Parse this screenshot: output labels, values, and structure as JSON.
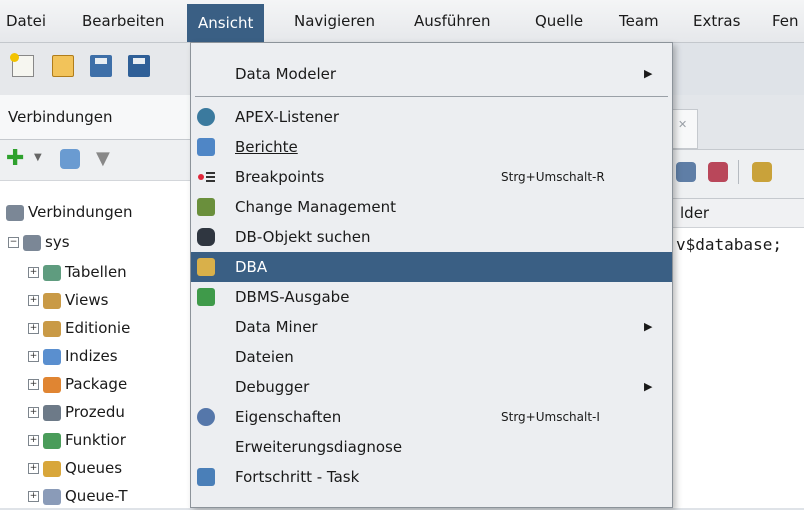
{
  "menubar": {
    "items": [
      {
        "label": "Datei"
      },
      {
        "label": "Bearbeiten"
      },
      {
        "label": "Ansicht"
      },
      {
        "label": "Navigieren"
      },
      {
        "label": "Ausführen"
      },
      {
        "label": "Quelle"
      },
      {
        "label": "Team"
      },
      {
        "label": "Extras"
      },
      {
        "label": "Fen"
      }
    ],
    "active": "Ansicht"
  },
  "toolbar": {
    "icons": [
      "new-icon",
      "open-folder-icon",
      "save-icon",
      "save-all-icon"
    ]
  },
  "connections_panel": {
    "tab_label": "Verbindungen",
    "tree": [
      {
        "label": "Verbindungen",
        "icon": "connections-icon"
      },
      {
        "label": "sys",
        "icon": "database-connection-icon"
      },
      {
        "label": "Tabellen",
        "icon": "table-icon"
      },
      {
        "label": "Views",
        "icon": "view-icon"
      },
      {
        "label": "Editionie",
        "icon": "editioning-view-icon"
      },
      {
        "label": "Indizes",
        "icon": "index-icon"
      },
      {
        "label": "Package",
        "icon": "package-icon"
      },
      {
        "label": "Prozedu",
        "icon": "procedure-icon"
      },
      {
        "label": "Funktior",
        "icon": "function-icon"
      },
      {
        "label": "Queues",
        "icon": "queue-icon"
      },
      {
        "label": "Queue-T",
        "icon": "queue-table-icon"
      }
    ]
  },
  "editor": {
    "column_header": "lder",
    "code_line": "v$database;"
  },
  "view_menu": {
    "items": [
      {
        "label": "Data Modeler",
        "submenu": true
      },
      {
        "separator": true
      },
      {
        "label": "APEX-Listener",
        "icon": "apex-listener-icon"
      },
      {
        "label": "Berichte",
        "icon": "reports-icon"
      },
      {
        "label": "Breakpoints",
        "icon": "breakpoints-icon",
        "accel": "Strg+Umschalt-R"
      },
      {
        "label": "Change Management",
        "icon": "change-management-icon"
      },
      {
        "label": "DB-Objekt suchen",
        "icon": "binoculars-icon"
      },
      {
        "label": "DBA",
        "icon": "dba-icon",
        "highlighted": true
      },
      {
        "label": "DBMS-Ausgabe",
        "icon": "dbms-output-icon"
      },
      {
        "label": "Data Miner",
        "submenu": true
      },
      {
        "label": "Dateien"
      },
      {
        "label": "Debugger",
        "submenu": true
      },
      {
        "label": "Eigenschaften",
        "icon": "properties-icon",
        "accel": "Strg+Umschalt-I"
      },
      {
        "label": "Erweiterungsdiagnose"
      },
      {
        "label": "Fortschritt - Task",
        "icon": "task-progress-icon"
      }
    ]
  },
  "colors": {
    "highlight": "#3a5f84",
    "menu_bg": "#eceef1"
  }
}
